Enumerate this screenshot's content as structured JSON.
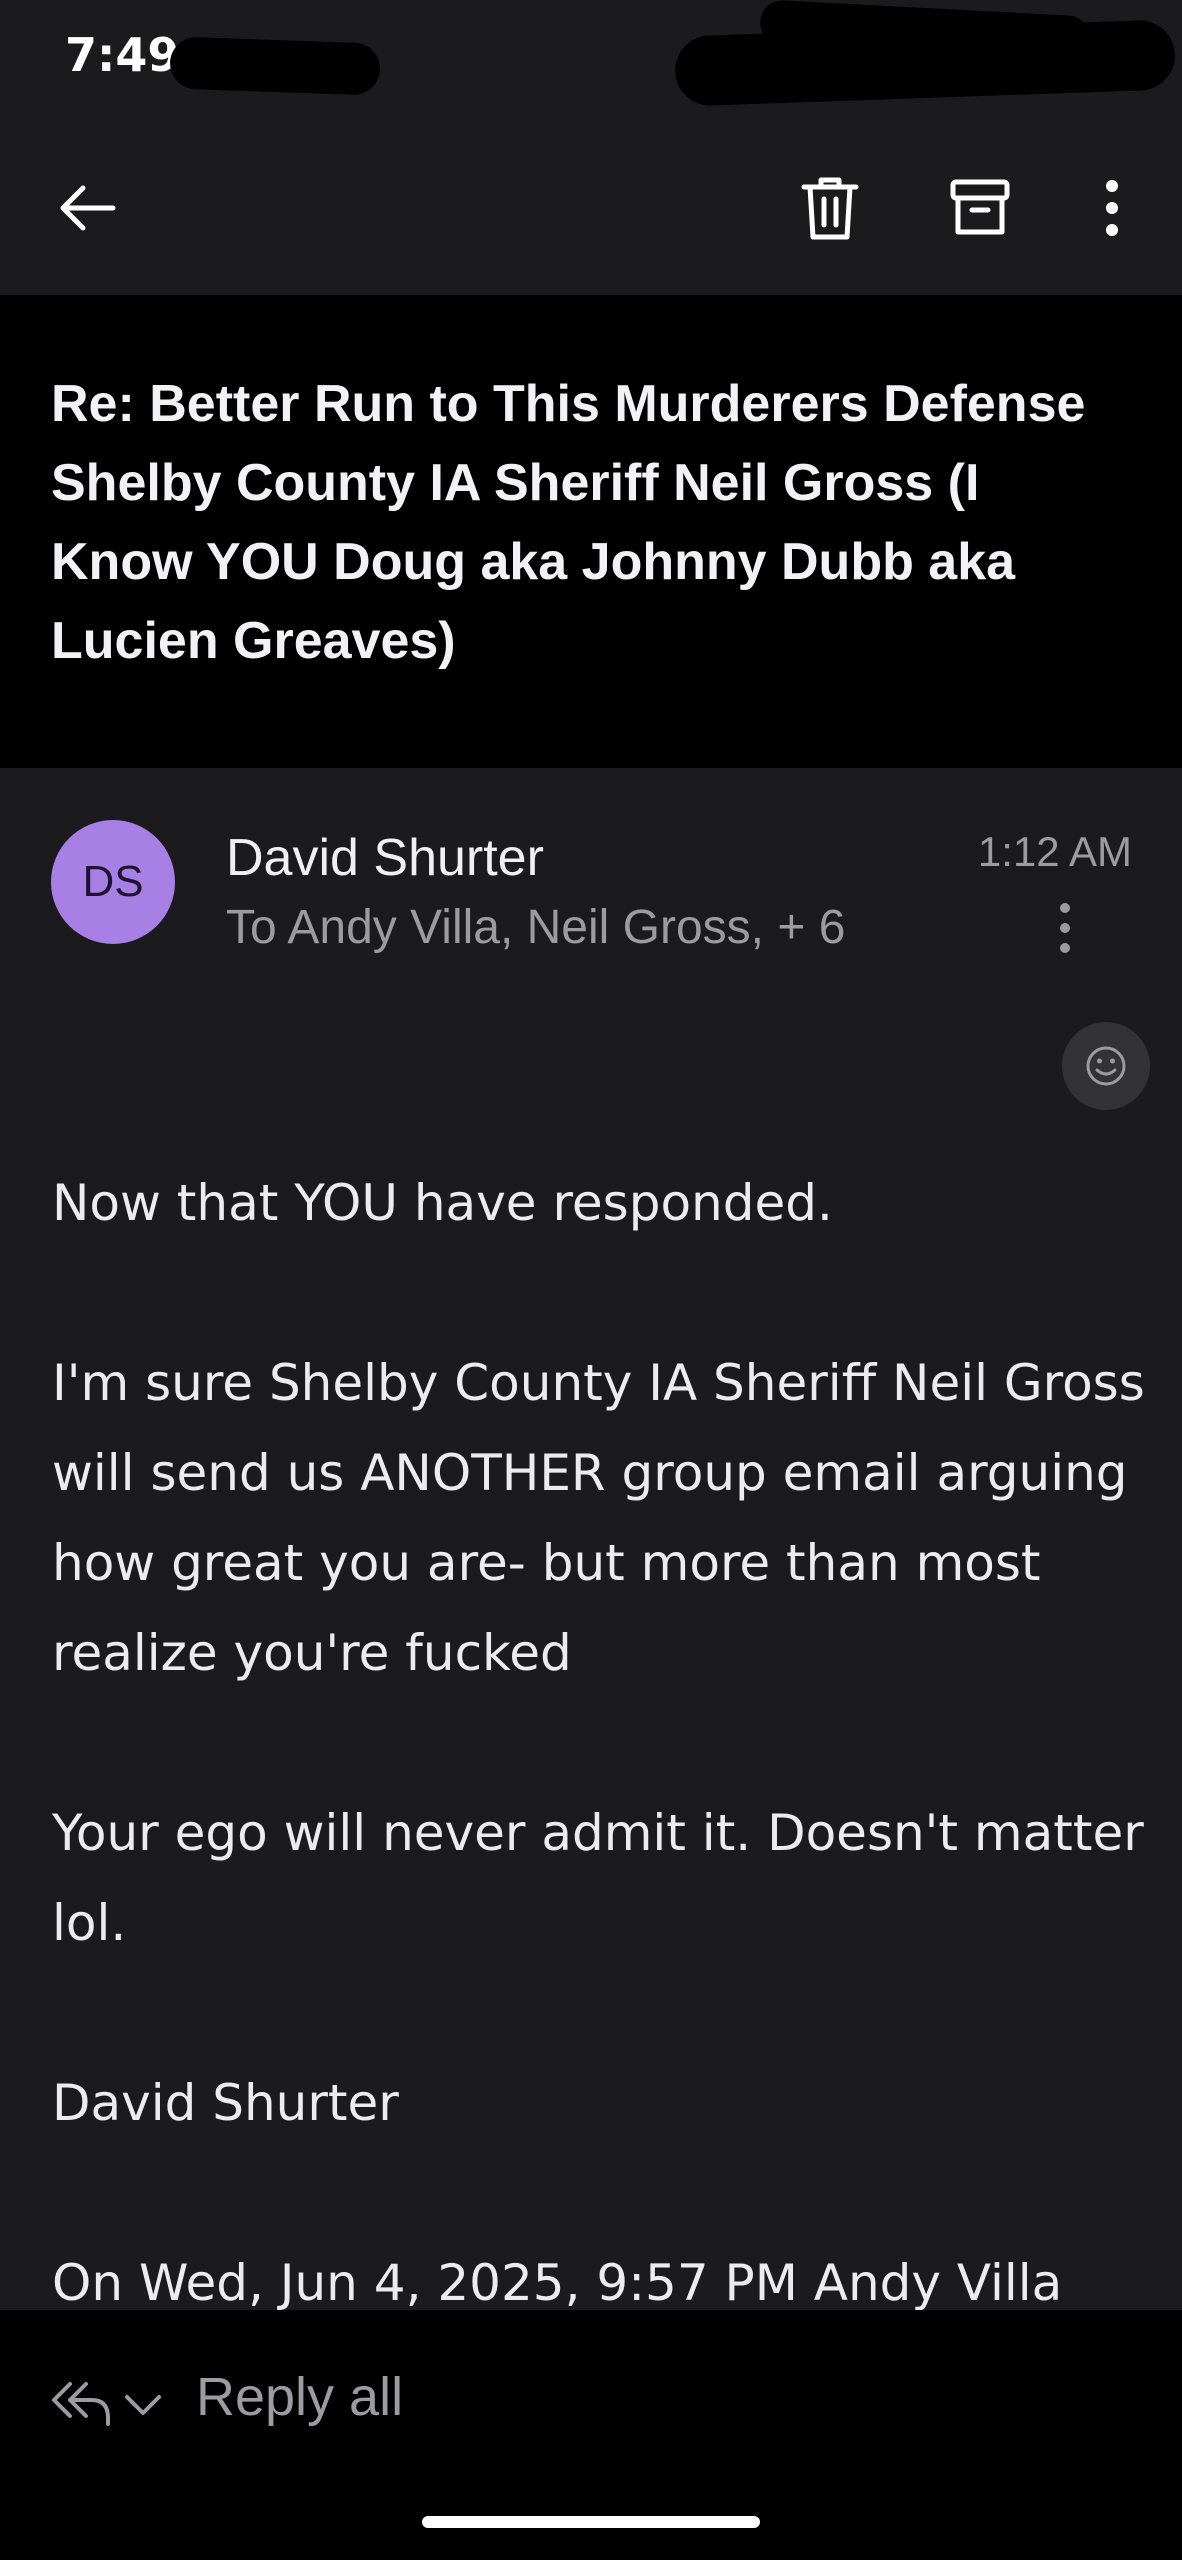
{
  "status_bar": {
    "time": "7:49"
  },
  "toolbar": {
    "back_icon": "arrow-left-icon",
    "delete_icon": "trash-icon",
    "archive_icon": "archive-box-icon",
    "more_icon": "more-vertical-icon"
  },
  "subject": "Re: Better Run to This Murderers Defense Shelby County IA Sheriff Neil Gross (I Know YOU Doug aka Johnny Dubb aka Lucien Greaves)",
  "message": {
    "avatar_initials": "DS",
    "avatar_color": "#a77fe5",
    "sender": "David Shurter",
    "recipients": "To Andy Villa, Neil Gross, + 6",
    "time": "1:12 AM",
    "body": [
      "Now that YOU have responded.",
      "I'm sure Shelby County IA Sheriff Neil Gross will send us ANOTHER group email arguing how great you are- but more than most realize you're fucked",
      "Your ego will never admit it. Doesn't matter lol.",
      "David Shurter"
    ],
    "quote_header": "On Wed, Jun 4, 2025, 9:57 PM Andy Villa"
  },
  "reply_bar": {
    "label": "Reply all",
    "icon": "reply-all-icon"
  }
}
